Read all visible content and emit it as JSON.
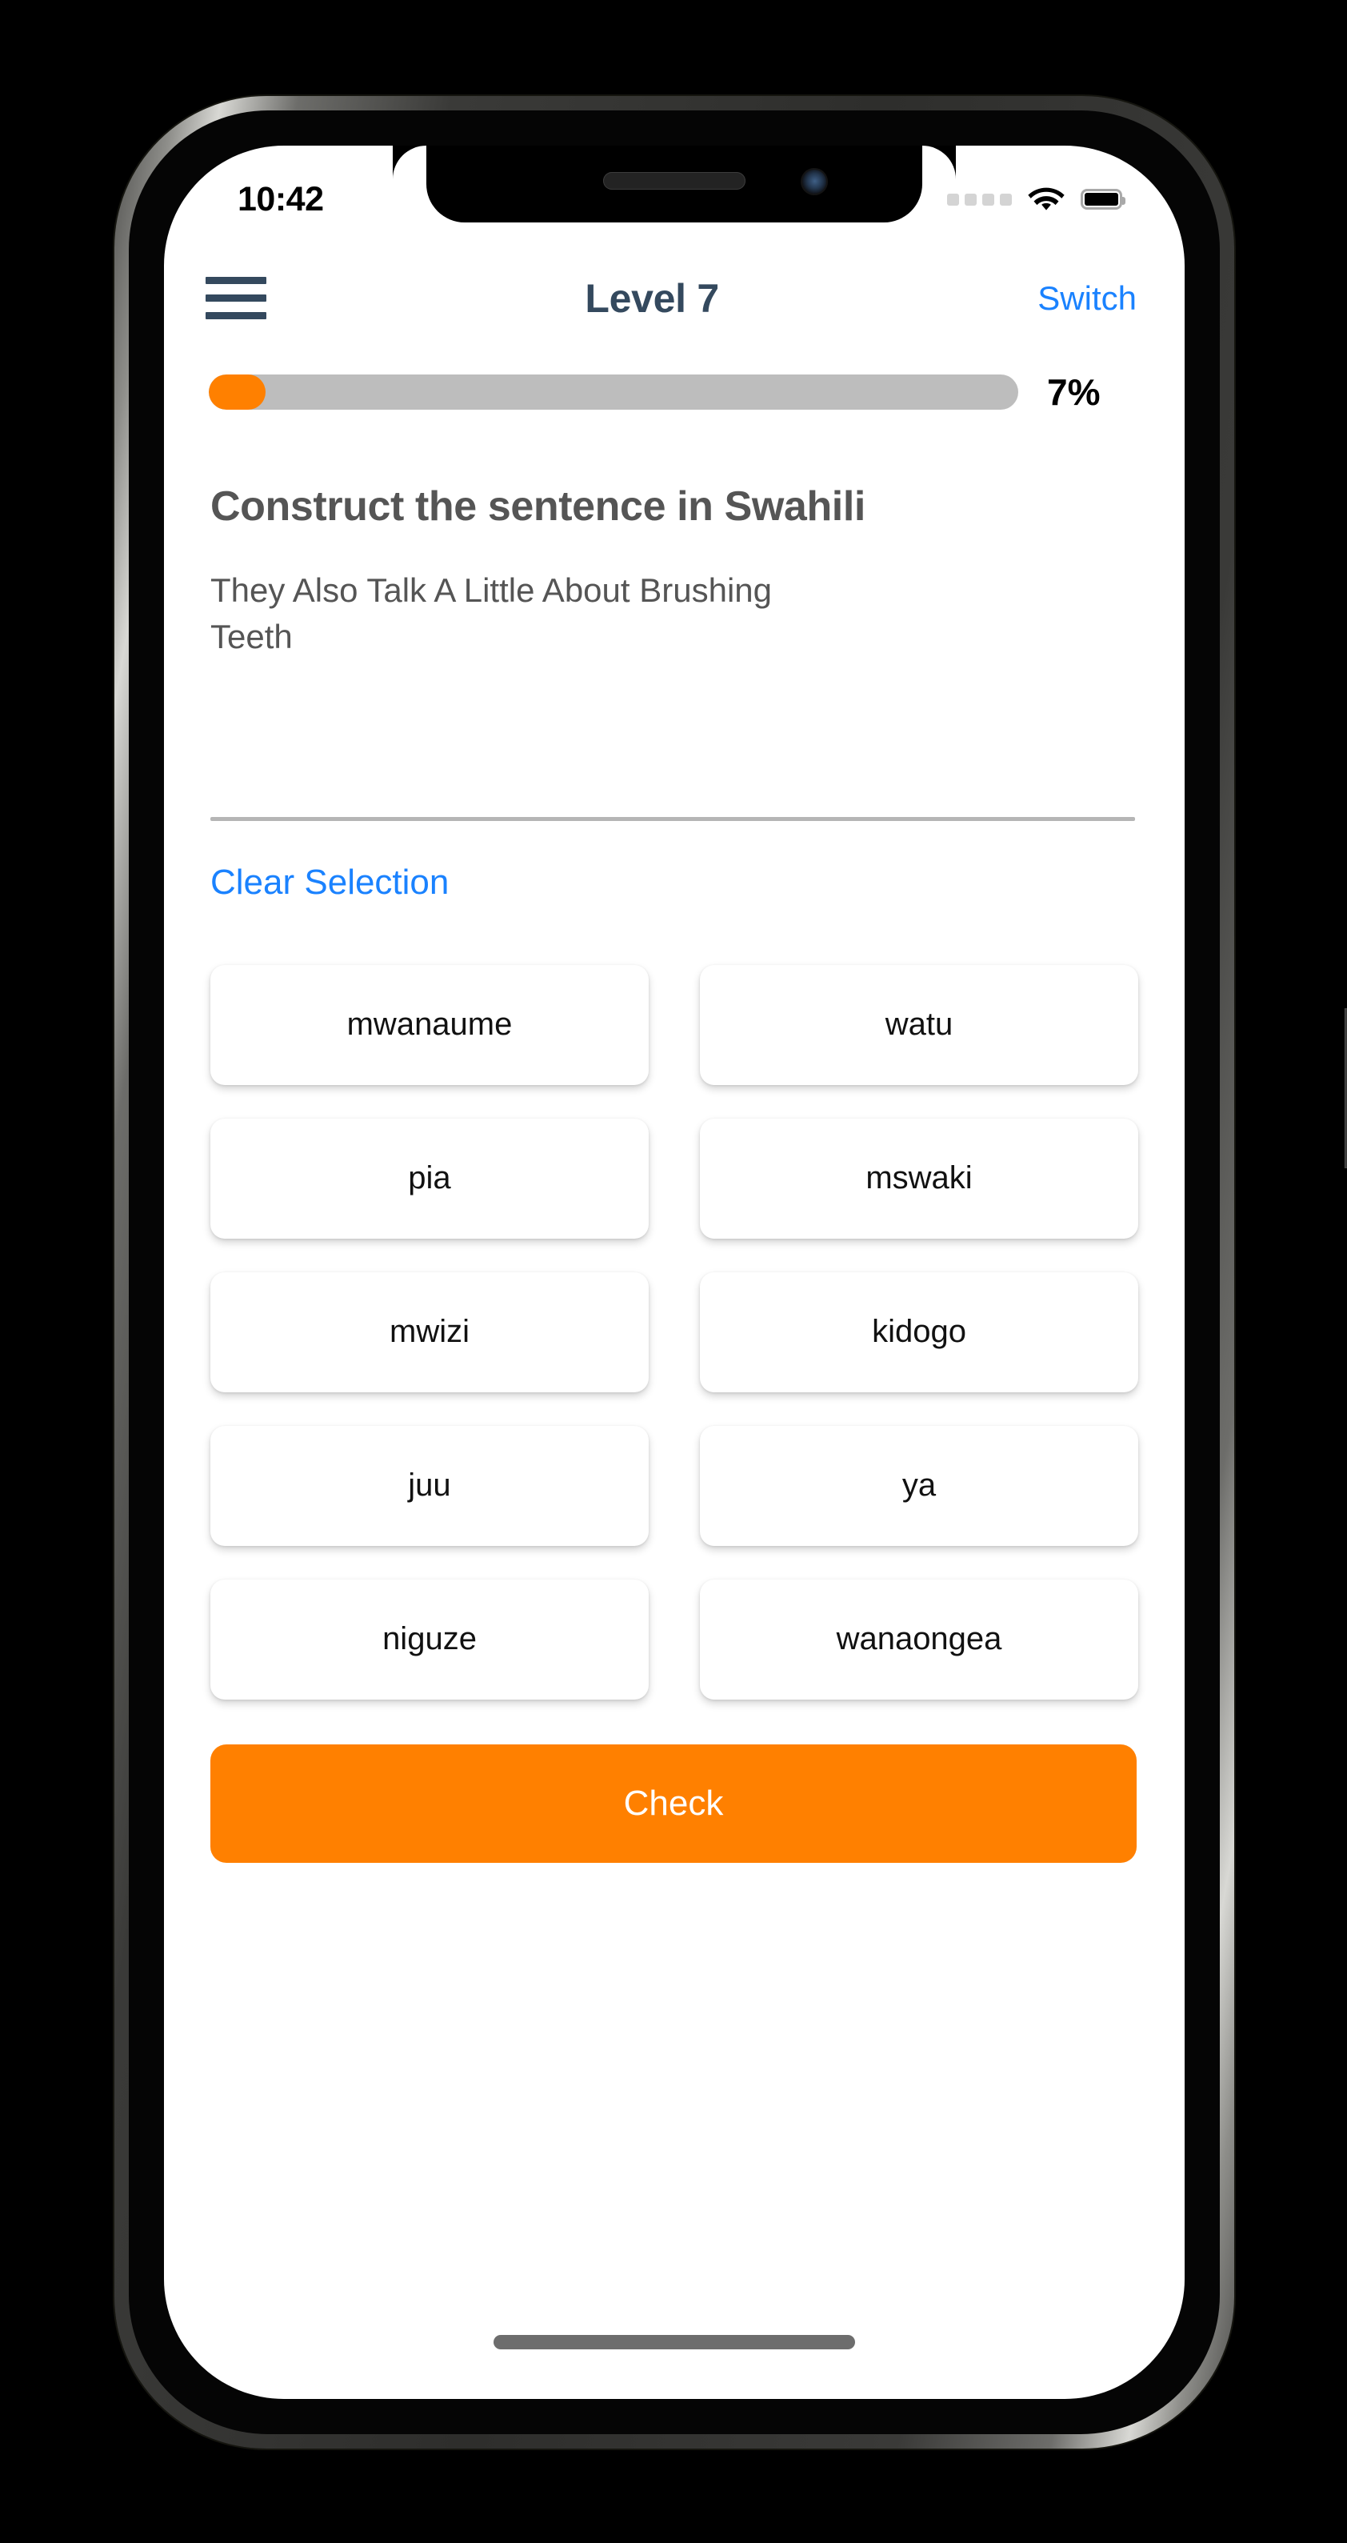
{
  "status_bar": {
    "time": "10:42",
    "cellular_icon": "cellular-dots-icon",
    "wifi_icon": "wifi-icon",
    "battery_icon": "battery-full-icon"
  },
  "header": {
    "menu_icon": "hamburger-menu-icon",
    "title": "Level 7",
    "switch_label": "Switch"
  },
  "progress": {
    "percent_label": "7%",
    "percent_value": 7,
    "fill_color": "#ff8000",
    "track_color": "#bdbdbd"
  },
  "exercise": {
    "heading": "Construct the sentence in Swahili",
    "sentence": "They Also Talk A Little About Brushing Teeth",
    "clear_label": "Clear Selection",
    "answer_slot_text": ""
  },
  "word_tiles": [
    {
      "label": "mwanaume"
    },
    {
      "label": "watu"
    },
    {
      "label": "pia"
    },
    {
      "label": "mswaki"
    },
    {
      "label": "mwizi"
    },
    {
      "label": "kidogo"
    },
    {
      "label": "juu"
    },
    {
      "label": "ya"
    },
    {
      "label": "niguze"
    },
    {
      "label": "wanaongea"
    }
  ],
  "check_button": {
    "label": "Check",
    "color": "#ff8000"
  },
  "theme": {
    "accent_orange": "#ff8000",
    "link_blue": "#1a82ff",
    "title_slate": "#34495e",
    "text_grey": "#555555"
  }
}
